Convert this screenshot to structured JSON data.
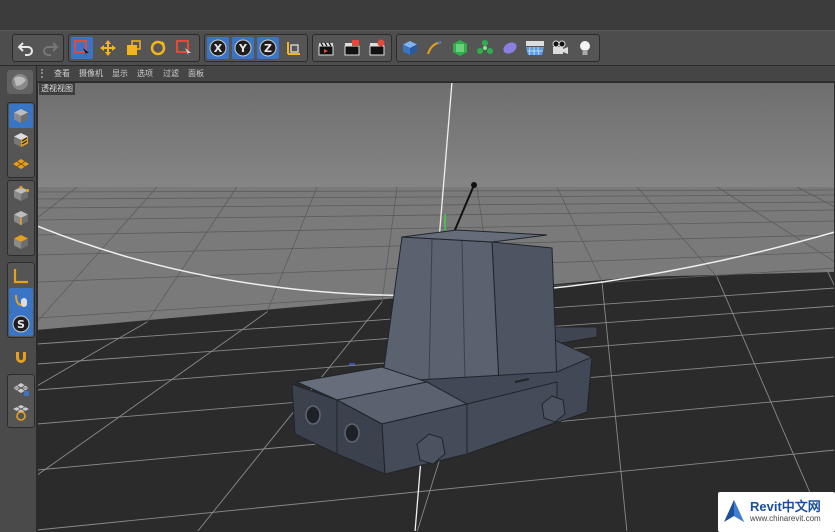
{
  "viewport": {
    "menu": [
      "查看",
      "摄像机",
      "显示",
      "选项",
      "过滤",
      "面板"
    ],
    "label": "透视视图"
  },
  "toolbar": {
    "axis_x": "X",
    "axis_y": "Y",
    "axis_z": "Z",
    "icons": [
      "undo-icon",
      "redo-icon",
      "live-selection-icon",
      "move-icon",
      "scale-icon",
      "rotate-icon",
      "recent-tool-icon",
      "axis-x-icon",
      "axis-y-icon",
      "axis-z-icon",
      "coordinate-system-icon",
      "render-view-icon",
      "render-picture-viewer-icon",
      "render-settings-icon",
      "cube-icon",
      "pen-spline-icon",
      "subdivision-icon",
      "cloner-icon",
      "deformer-icon",
      "floor-icon",
      "camera-icon",
      "light-icon"
    ]
  },
  "sidebar": {
    "mode_s_label": "S",
    "icons": [
      "make-editable-icon",
      "model-mode-icon",
      "texture-mode-icon",
      "workplane-icon",
      "points-mode-icon",
      "edges-mode-icon",
      "polygons-mode-icon",
      "axis-mode-icon",
      "tweak-mode-icon",
      "snap-icon",
      "magnet-icon",
      "lock-workplane-icon",
      "solo-icon"
    ]
  },
  "watermark": {
    "title": "Revit中文网",
    "url": "www.chinarevit.com"
  },
  "colors": {
    "toolbar_bg": "#4d4d4d",
    "viewport_sky": "#7b7b7b",
    "viewport_floor": "#2b2b2b",
    "model": "#4b5360",
    "accent_blue": "#3a74c4",
    "accent_orange": "#e6a01e"
  }
}
